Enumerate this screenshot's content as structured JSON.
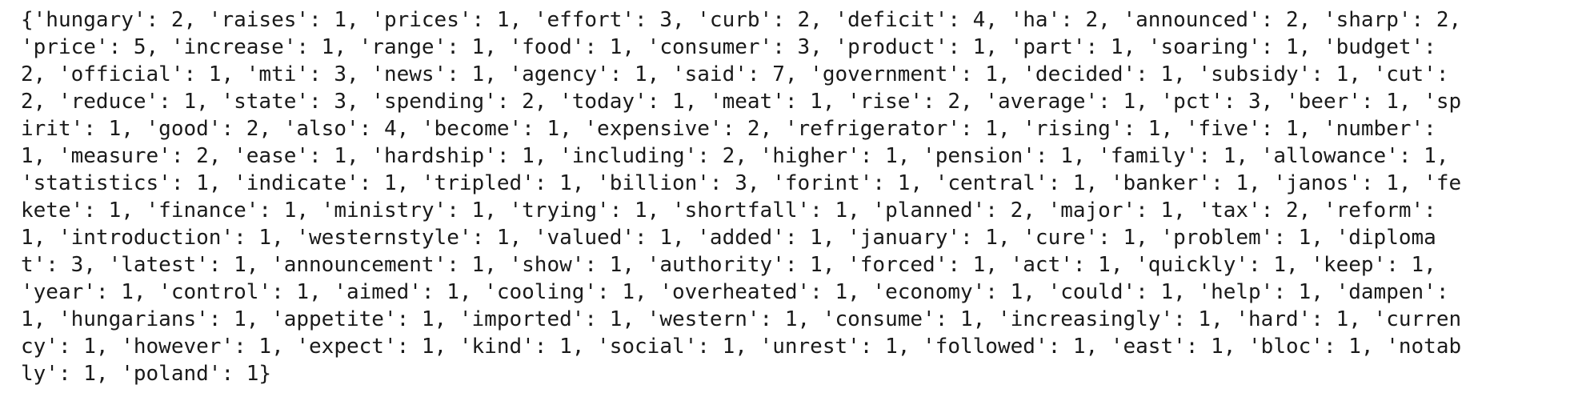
{
  "output": {
    "lines": [
      "{'hungary': 2, 'raises': 1, 'prices': 1, 'effort': 3, 'curb': 2, 'deficit': 4, 'ha': 2, 'announced': 2, 'sharp': 2,",
      "'price': 5, 'increase': 1, 'range': 1, 'food': 1, 'consumer': 3, 'product': 1, 'part': 1, 'soaring': 1, 'budget':",
      "2, 'official': 1, 'mti': 3, 'news': 1, 'agency': 1, 'said': 7, 'government': 1, 'decided': 1, 'subsidy': 1, 'cut':",
      "2, 'reduce': 1, 'state': 3, 'spending': 2, 'today': 1, 'meat': 1, 'rise': 2, 'average': 1, 'pct': 3, 'beer': 1, 'sp",
      "irit': 1, 'good': 2, 'also': 4, 'become': 1, 'expensive': 2, 'refrigerator': 1, 'rising': 1, 'five': 1, 'number':",
      "1, 'measure': 2, 'ease': 1, 'hardship': 1, 'including': 2, 'higher': 1, 'pension': 1, 'family': 1, 'allowance': 1,",
      "'statistics': 1, 'indicate': 1, 'tripled': 1, 'billion': 3, 'forint': 1, 'central': 1, 'banker': 1, 'janos': 1, 'fe",
      "kete': 1, 'finance': 1, 'ministry': 1, 'trying': 1, 'shortfall': 1, 'planned': 2, 'major': 1, 'tax': 2, 'reform':",
      "1, 'introduction': 1, 'westernstyle': 1, 'valued': 1, 'added': 1, 'january': 1, 'cure': 1, 'problem': 1, 'diploma",
      "t': 3, 'latest': 1, 'announcement': 1, 'show': 1, 'authority': 1, 'forced': 1, 'act': 1, 'quickly': 1, 'keep': 1,",
      "'year': 1, 'control': 1, 'aimed': 1, 'cooling': 1, 'overheated': 1, 'economy': 1, 'could': 1, 'help': 1, 'dampen':",
      "1, 'hungarians': 1, 'appetite': 1, 'imported': 1, 'western': 1, 'consume': 1, 'increasingly': 1, 'hard': 1, 'curren",
      "cy': 1, 'however': 1, 'expect': 1, 'kind': 1, 'social': 1, 'unrest': 1, 'followed': 1, 'east': 1, 'bloc': 1, 'notab",
      "ly': 1, 'poland': 1}"
    ]
  }
}
